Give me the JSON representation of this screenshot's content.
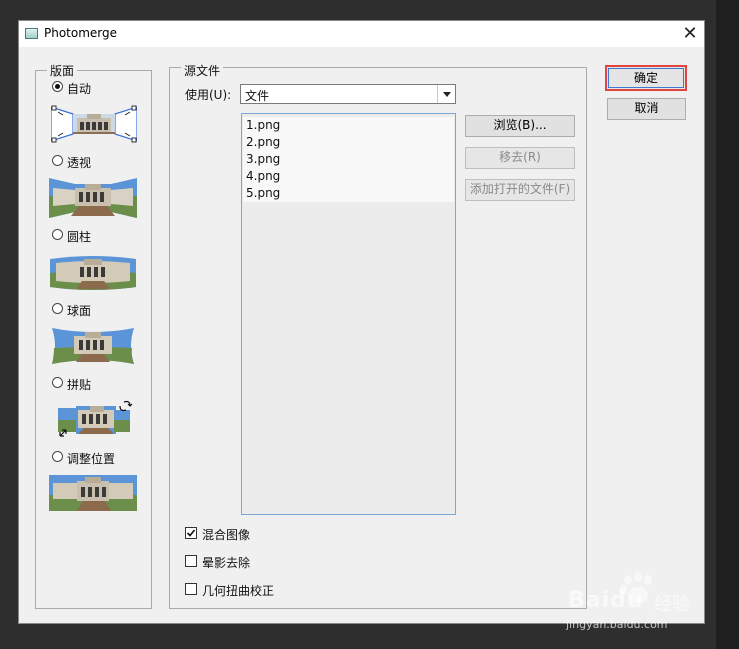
{
  "window": {
    "title": "Photomerge",
    "close_glyph": "✕"
  },
  "layout_group": {
    "label": "版面",
    "options": [
      {
        "label": "自动",
        "selected": true
      },
      {
        "label": "透视",
        "selected": false
      },
      {
        "label": "圆柱",
        "selected": false
      },
      {
        "label": "球面",
        "selected": false
      },
      {
        "label": "拼贴",
        "selected": false
      },
      {
        "label": "调整位置",
        "selected": false
      }
    ]
  },
  "source_group": {
    "label": "源文件",
    "use_label": "使用(U):",
    "use_value": "文件",
    "files": [
      "1.png",
      "2.png",
      "3.png",
      "4.png",
      "5.png"
    ],
    "browse_label": "浏览(B)...",
    "remove_label": "移去(R)",
    "add_open_label": "添加打开的文件(F)"
  },
  "options": [
    {
      "label": "混合图像",
      "checked": true
    },
    {
      "label": "晕影去除",
      "checked": false
    },
    {
      "label": "几何扭曲校正",
      "checked": false
    }
  ],
  "buttons": {
    "ok_label": "确定",
    "cancel_label": "取消"
  },
  "watermark": {
    "brand": "Baidu",
    "brand_cn": "经验",
    "url": "jingyan.baidu.com"
  },
  "colors": {
    "ok_highlight": "#e0453f",
    "list_border": "#7aa7d6",
    "dialog_bg": "#f0f0f0"
  }
}
